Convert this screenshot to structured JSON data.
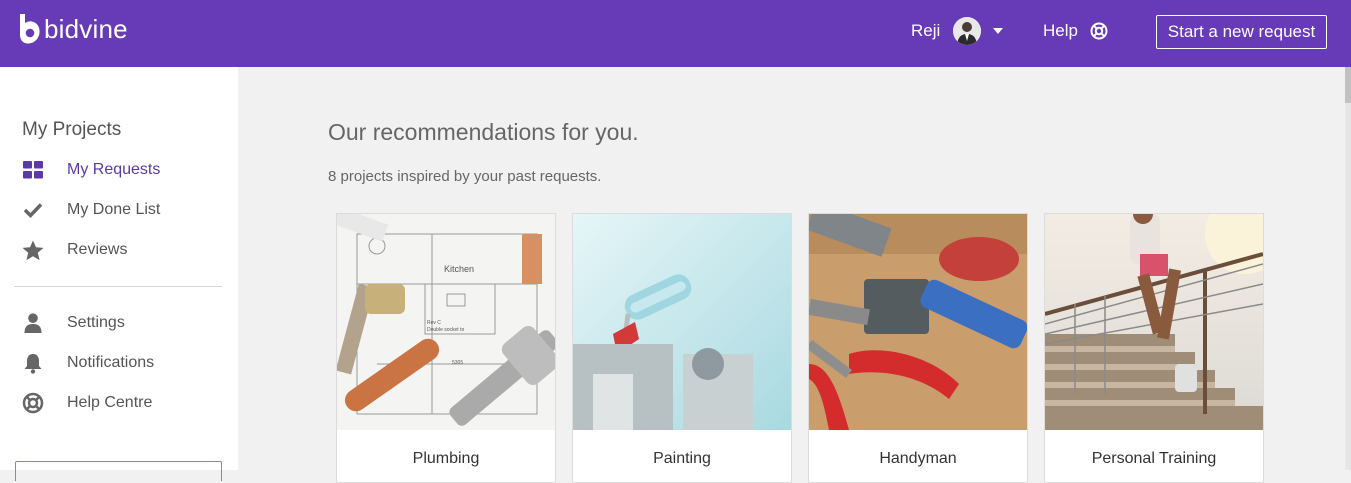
{
  "app": {
    "brand": "bidvine",
    "accent": "#673ab7"
  },
  "header": {
    "user_name": "Reji",
    "help_label": "Help",
    "cta_label": "Start a new request"
  },
  "sidebar": {
    "title": "My Projects",
    "items": [
      {
        "label": "My Requests",
        "icon": "grid-icon",
        "active": true
      },
      {
        "label": "My Done List",
        "icon": "check-icon"
      },
      {
        "label": "Reviews",
        "icon": "star-icon"
      },
      {
        "label": "Settings",
        "icon": "person-icon"
      },
      {
        "label": "Notifications",
        "icon": "bell-icon"
      },
      {
        "label": "Help Centre",
        "icon": "lifebuoy-icon"
      }
    ]
  },
  "main": {
    "title": "Our recommendations for you.",
    "subtitle": "8 projects inspired by your past requests.",
    "cards": [
      {
        "label": "Plumbing"
      },
      {
        "label": "Painting"
      },
      {
        "label": "Handyman"
      },
      {
        "label": "Personal Training"
      }
    ]
  }
}
